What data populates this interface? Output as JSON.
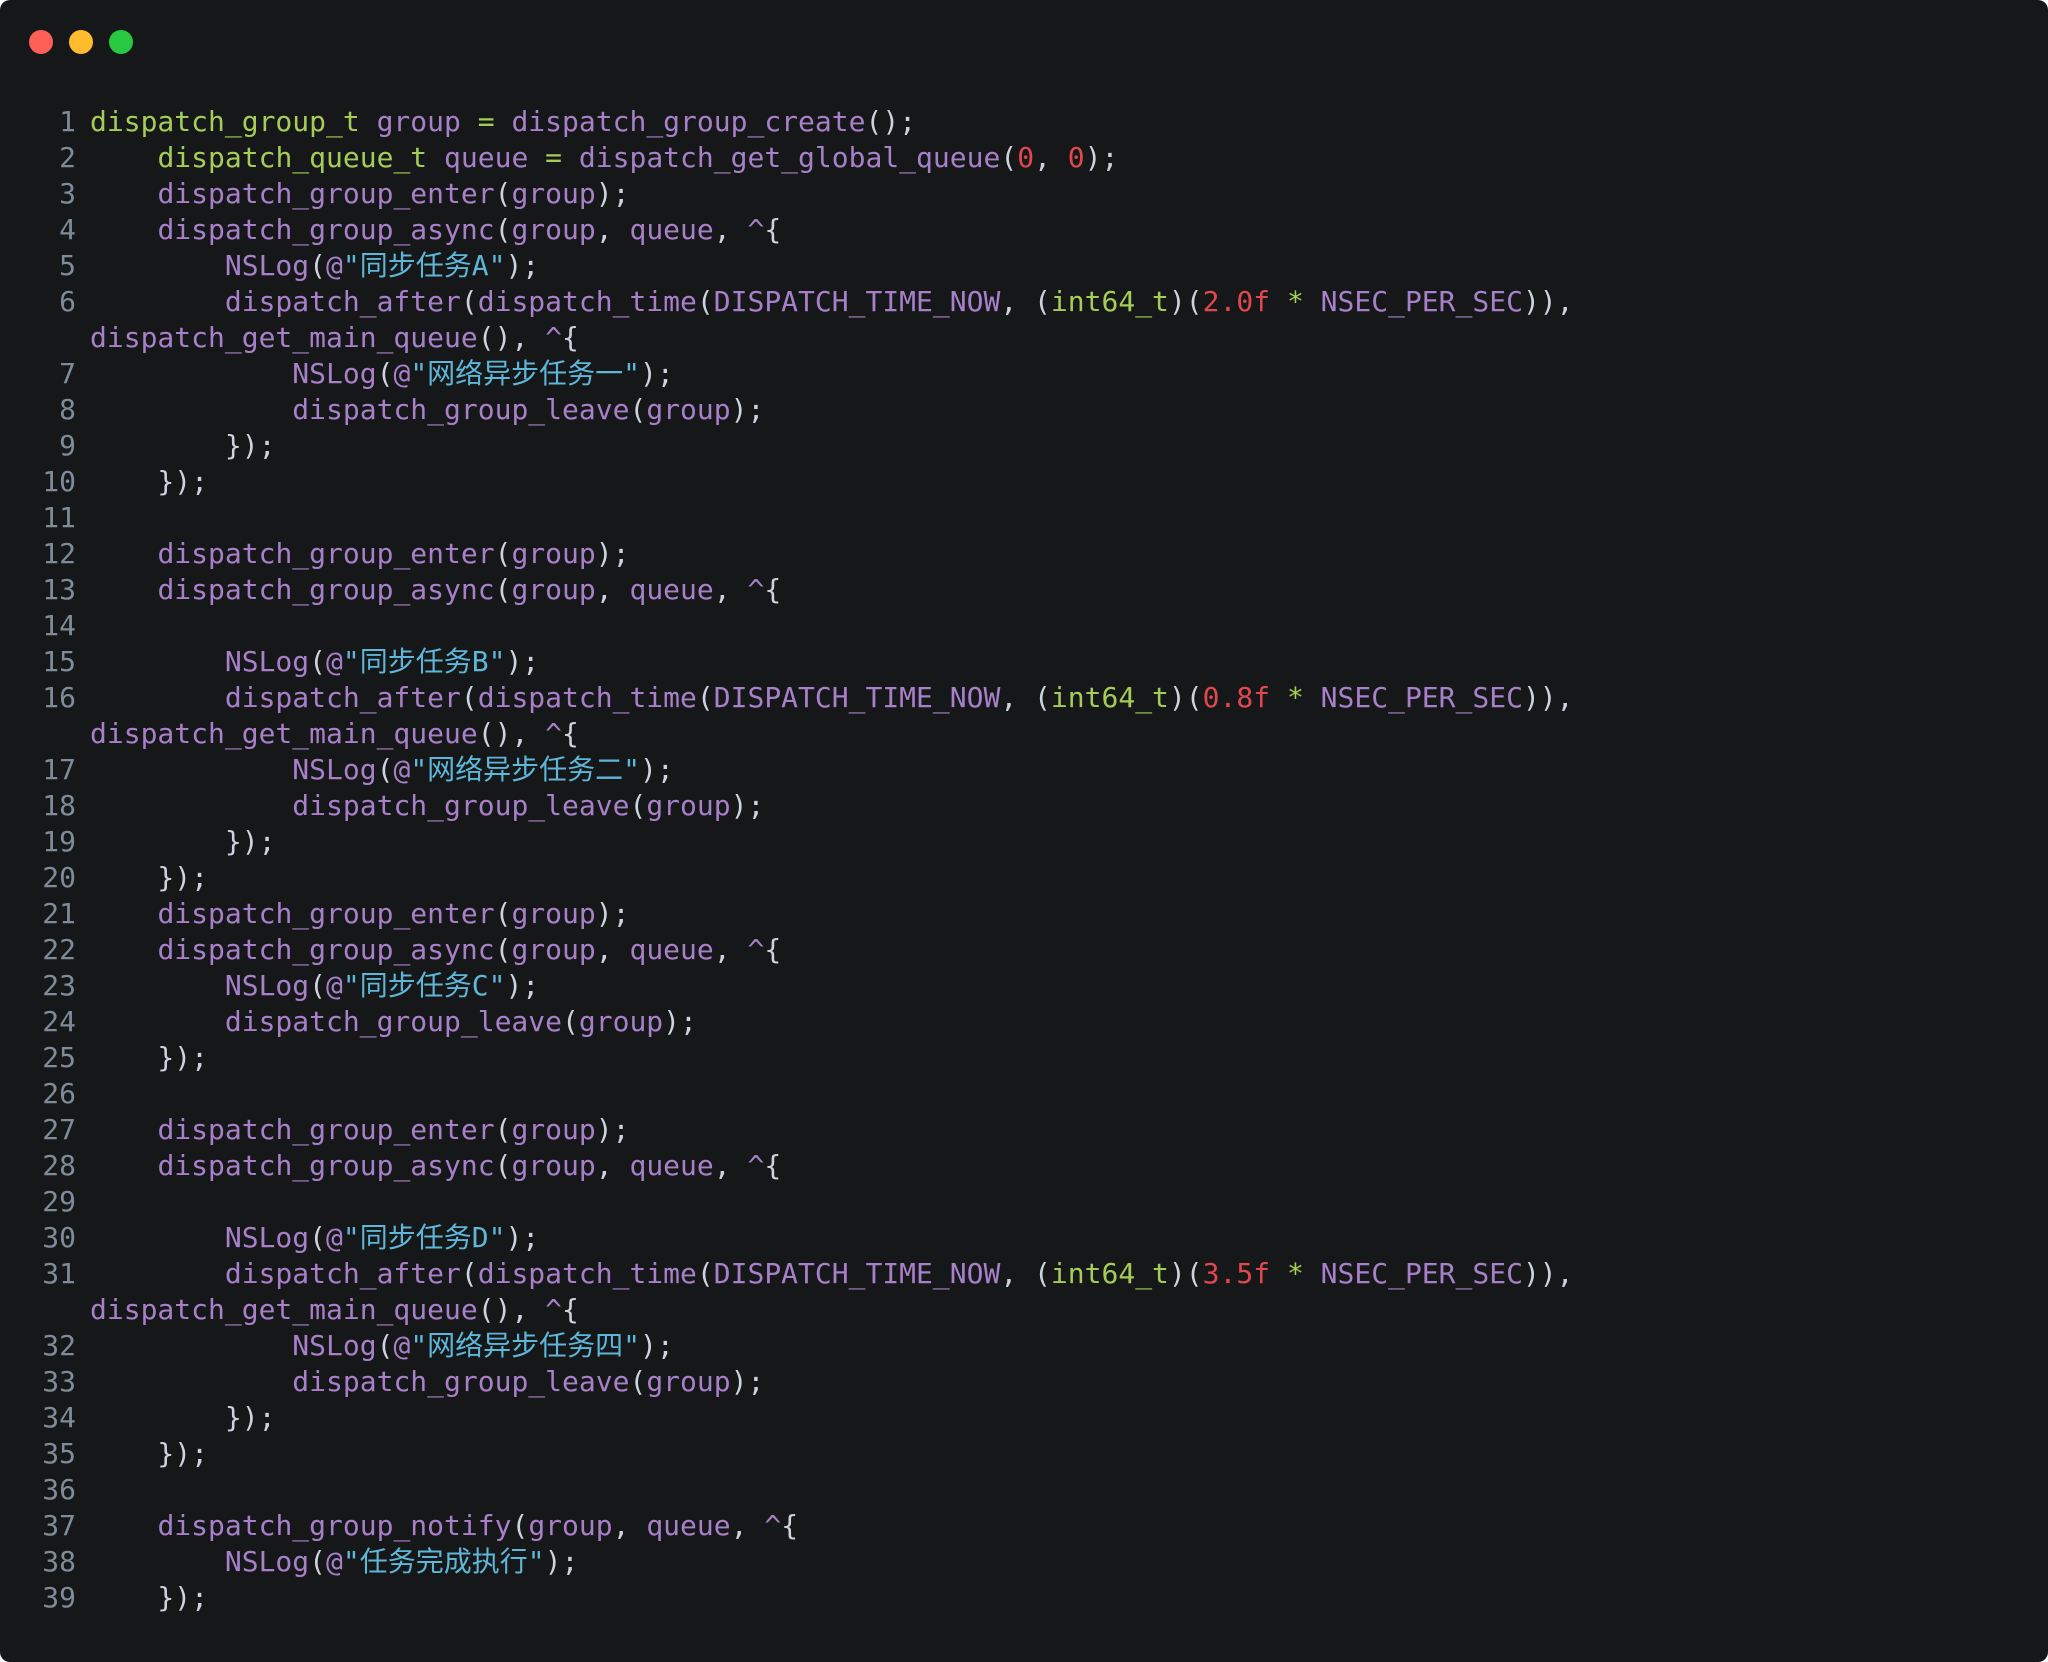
{
  "window": {
    "controls": {
      "close_color": "#fe5f57",
      "minimize_color": "#febc2e",
      "zoom_color": "#28c840"
    }
  },
  "theme": {
    "background": "#151719",
    "text": "#cdd3de",
    "line_number": "#7f8b98",
    "type": "#a6cc58",
    "function": "#a880c9",
    "number": "#e0474f",
    "string": "#5eb6d8"
  },
  "code_lines": [
    {
      "n": "1",
      "tokens": [
        [
          "type",
          "dispatch_group_t"
        ],
        [
          "p",
          " "
        ],
        [
          "fn",
          "group"
        ],
        [
          "p",
          " "
        ],
        [
          "op",
          "="
        ],
        [
          "p",
          " "
        ],
        [
          "fn",
          "dispatch_group_create"
        ],
        [
          "p",
          "();"
        ]
      ]
    },
    {
      "n": "2",
      "tokens": [
        [
          "p",
          "    "
        ],
        [
          "type",
          "dispatch_queue_t"
        ],
        [
          "p",
          " "
        ],
        [
          "fn",
          "queue"
        ],
        [
          "p",
          " "
        ],
        [
          "op",
          "="
        ],
        [
          "p",
          " "
        ],
        [
          "fn",
          "dispatch_get_global_queue"
        ],
        [
          "p",
          "("
        ],
        [
          "num",
          "0"
        ],
        [
          "p",
          ", "
        ],
        [
          "num",
          "0"
        ],
        [
          "p",
          ");"
        ]
      ]
    },
    {
      "n": "3",
      "tokens": [
        [
          "p",
          "    "
        ],
        [
          "fn",
          "dispatch_group_enter"
        ],
        [
          "p",
          "("
        ],
        [
          "fn",
          "group"
        ],
        [
          "p",
          ");"
        ]
      ]
    },
    {
      "n": "4",
      "tokens": [
        [
          "p",
          "    "
        ],
        [
          "fn",
          "dispatch_group_async"
        ],
        [
          "p",
          "("
        ],
        [
          "fn",
          "group"
        ],
        [
          "p",
          ", "
        ],
        [
          "fn",
          "queue"
        ],
        [
          "p",
          ", "
        ],
        [
          "fn",
          "^"
        ],
        [
          "p",
          "{"
        ]
      ]
    },
    {
      "n": "5",
      "tokens": [
        [
          "p",
          "        "
        ],
        [
          "fn",
          "NSLog"
        ],
        [
          "p",
          "("
        ],
        [
          "fn",
          "@"
        ],
        [
          "str",
          "\"同步任务A\""
        ],
        [
          "p",
          ");"
        ]
      ]
    },
    {
      "n": "6",
      "tokens": [
        [
          "p",
          "        "
        ],
        [
          "fn",
          "dispatch_after"
        ],
        [
          "p",
          "("
        ],
        [
          "fn",
          "dispatch_time"
        ],
        [
          "p",
          "("
        ],
        [
          "fn",
          "DISPATCH_TIME_NOW"
        ],
        [
          "p",
          ", ("
        ],
        [
          "type",
          "int64_t"
        ],
        [
          "p",
          ")("
        ],
        [
          "num",
          "2.0f"
        ],
        [
          "p",
          " "
        ],
        [
          "op",
          "*"
        ],
        [
          "p",
          " "
        ],
        [
          "fn",
          "NSEC_PER_SEC"
        ],
        [
          "p",
          ")),"
        ]
      ]
    },
    {
      "n": "",
      "tokens": [
        [
          "fn",
          "dispatch_get_main_queue"
        ],
        [
          "p",
          "(), "
        ],
        [
          "fn",
          "^"
        ],
        [
          "p",
          "{"
        ]
      ]
    },
    {
      "n": "7",
      "tokens": [
        [
          "p",
          "            "
        ],
        [
          "fn",
          "NSLog"
        ],
        [
          "p",
          "("
        ],
        [
          "fn",
          "@"
        ],
        [
          "str",
          "\"网络异步任务一\""
        ],
        [
          "p",
          ");"
        ]
      ]
    },
    {
      "n": "8",
      "tokens": [
        [
          "p",
          "            "
        ],
        [
          "fn",
          "dispatch_group_leave"
        ],
        [
          "p",
          "("
        ],
        [
          "fn",
          "group"
        ],
        [
          "p",
          ");"
        ]
      ]
    },
    {
      "n": "9",
      "tokens": [
        [
          "p",
          "        });"
        ]
      ]
    },
    {
      "n": "10",
      "tokens": [
        [
          "p",
          "    });"
        ]
      ]
    },
    {
      "n": "11",
      "tokens": []
    },
    {
      "n": "12",
      "tokens": [
        [
          "p",
          "    "
        ],
        [
          "fn",
          "dispatch_group_enter"
        ],
        [
          "p",
          "("
        ],
        [
          "fn",
          "group"
        ],
        [
          "p",
          ");"
        ]
      ]
    },
    {
      "n": "13",
      "tokens": [
        [
          "p",
          "    "
        ],
        [
          "fn",
          "dispatch_group_async"
        ],
        [
          "p",
          "("
        ],
        [
          "fn",
          "group"
        ],
        [
          "p",
          ", "
        ],
        [
          "fn",
          "queue"
        ],
        [
          "p",
          ", "
        ],
        [
          "fn",
          "^"
        ],
        [
          "p",
          "{"
        ]
      ]
    },
    {
      "n": "14",
      "tokens": []
    },
    {
      "n": "15",
      "tokens": [
        [
          "p",
          "        "
        ],
        [
          "fn",
          "NSLog"
        ],
        [
          "p",
          "("
        ],
        [
          "fn",
          "@"
        ],
        [
          "str",
          "\"同步任务B\""
        ],
        [
          "p",
          ");"
        ]
      ]
    },
    {
      "n": "16",
      "tokens": [
        [
          "p",
          "        "
        ],
        [
          "fn",
          "dispatch_after"
        ],
        [
          "p",
          "("
        ],
        [
          "fn",
          "dispatch_time"
        ],
        [
          "p",
          "("
        ],
        [
          "fn",
          "DISPATCH_TIME_NOW"
        ],
        [
          "p",
          ", ("
        ],
        [
          "type",
          "int64_t"
        ],
        [
          "p",
          ")("
        ],
        [
          "num",
          "0.8f"
        ],
        [
          "p",
          " "
        ],
        [
          "op",
          "*"
        ],
        [
          "p",
          " "
        ],
        [
          "fn",
          "NSEC_PER_SEC"
        ],
        [
          "p",
          ")),"
        ]
      ]
    },
    {
      "n": "",
      "tokens": [
        [
          "fn",
          "dispatch_get_main_queue"
        ],
        [
          "p",
          "(), "
        ],
        [
          "fn",
          "^"
        ],
        [
          "p",
          "{"
        ]
      ]
    },
    {
      "n": "17",
      "tokens": [
        [
          "p",
          "            "
        ],
        [
          "fn",
          "NSLog"
        ],
        [
          "p",
          "("
        ],
        [
          "fn",
          "@"
        ],
        [
          "str",
          "\"网络异步任务二\""
        ],
        [
          "p",
          ");"
        ]
      ]
    },
    {
      "n": "18",
      "tokens": [
        [
          "p",
          "            "
        ],
        [
          "fn",
          "dispatch_group_leave"
        ],
        [
          "p",
          "("
        ],
        [
          "fn",
          "group"
        ],
        [
          "p",
          ");"
        ]
      ]
    },
    {
      "n": "19",
      "tokens": [
        [
          "p",
          "        });"
        ]
      ]
    },
    {
      "n": "20",
      "tokens": [
        [
          "p",
          "    });"
        ]
      ]
    },
    {
      "n": "21",
      "tokens": [
        [
          "p",
          "    "
        ],
        [
          "fn",
          "dispatch_group_enter"
        ],
        [
          "p",
          "("
        ],
        [
          "fn",
          "group"
        ],
        [
          "p",
          ");"
        ]
      ]
    },
    {
      "n": "22",
      "tokens": [
        [
          "p",
          "    "
        ],
        [
          "fn",
          "dispatch_group_async"
        ],
        [
          "p",
          "("
        ],
        [
          "fn",
          "group"
        ],
        [
          "p",
          ", "
        ],
        [
          "fn",
          "queue"
        ],
        [
          "p",
          ", "
        ],
        [
          "fn",
          "^"
        ],
        [
          "p",
          "{"
        ]
      ]
    },
    {
      "n": "23",
      "tokens": [
        [
          "p",
          "        "
        ],
        [
          "fn",
          "NSLog"
        ],
        [
          "p",
          "("
        ],
        [
          "fn",
          "@"
        ],
        [
          "str",
          "\"同步任务C\""
        ],
        [
          "p",
          ");"
        ]
      ]
    },
    {
      "n": "24",
      "tokens": [
        [
          "p",
          "        "
        ],
        [
          "fn",
          "dispatch_group_leave"
        ],
        [
          "p",
          "("
        ],
        [
          "fn",
          "group"
        ],
        [
          "p",
          ");"
        ]
      ]
    },
    {
      "n": "25",
      "tokens": [
        [
          "p",
          "    });"
        ]
      ]
    },
    {
      "n": "26",
      "tokens": []
    },
    {
      "n": "27",
      "tokens": [
        [
          "p",
          "    "
        ],
        [
          "fn",
          "dispatch_group_enter"
        ],
        [
          "p",
          "("
        ],
        [
          "fn",
          "group"
        ],
        [
          "p",
          ");"
        ]
      ]
    },
    {
      "n": "28",
      "tokens": [
        [
          "p",
          "    "
        ],
        [
          "fn",
          "dispatch_group_async"
        ],
        [
          "p",
          "("
        ],
        [
          "fn",
          "group"
        ],
        [
          "p",
          ", "
        ],
        [
          "fn",
          "queue"
        ],
        [
          "p",
          ", "
        ],
        [
          "fn",
          "^"
        ],
        [
          "p",
          "{"
        ]
      ]
    },
    {
      "n": "29",
      "tokens": []
    },
    {
      "n": "30",
      "tokens": [
        [
          "p",
          "        "
        ],
        [
          "fn",
          "NSLog"
        ],
        [
          "p",
          "("
        ],
        [
          "fn",
          "@"
        ],
        [
          "str",
          "\"同步任务D\""
        ],
        [
          "p",
          ");"
        ]
      ]
    },
    {
      "n": "31",
      "tokens": [
        [
          "p",
          "        "
        ],
        [
          "fn",
          "dispatch_after"
        ],
        [
          "p",
          "("
        ],
        [
          "fn",
          "dispatch_time"
        ],
        [
          "p",
          "("
        ],
        [
          "fn",
          "DISPATCH_TIME_NOW"
        ],
        [
          "p",
          ", ("
        ],
        [
          "type",
          "int64_t"
        ],
        [
          "p",
          ")("
        ],
        [
          "num",
          "3.5f"
        ],
        [
          "p",
          " "
        ],
        [
          "op",
          "*"
        ],
        [
          "p",
          " "
        ],
        [
          "fn",
          "NSEC_PER_SEC"
        ],
        [
          "p",
          ")),"
        ]
      ]
    },
    {
      "n": "",
      "tokens": [
        [
          "fn",
          "dispatch_get_main_queue"
        ],
        [
          "p",
          "(), "
        ],
        [
          "fn",
          "^"
        ],
        [
          "p",
          "{"
        ]
      ]
    },
    {
      "n": "32",
      "tokens": [
        [
          "p",
          "            "
        ],
        [
          "fn",
          "NSLog"
        ],
        [
          "p",
          "("
        ],
        [
          "fn",
          "@"
        ],
        [
          "str",
          "\"网络异步任务四\""
        ],
        [
          "p",
          ");"
        ]
      ]
    },
    {
      "n": "33",
      "tokens": [
        [
          "p",
          "            "
        ],
        [
          "fn",
          "dispatch_group_leave"
        ],
        [
          "p",
          "("
        ],
        [
          "fn",
          "group"
        ],
        [
          "p",
          ");"
        ]
      ]
    },
    {
      "n": "34",
      "tokens": [
        [
          "p",
          "        });"
        ]
      ]
    },
    {
      "n": "35",
      "tokens": [
        [
          "p",
          "    });"
        ]
      ]
    },
    {
      "n": "36",
      "tokens": []
    },
    {
      "n": "37",
      "tokens": [
        [
          "p",
          "    "
        ],
        [
          "fn",
          "dispatch_group_notify"
        ],
        [
          "p",
          "("
        ],
        [
          "fn",
          "group"
        ],
        [
          "p",
          ", "
        ],
        [
          "fn",
          "queue"
        ],
        [
          "p",
          ", "
        ],
        [
          "fn",
          "^"
        ],
        [
          "p",
          "{"
        ]
      ]
    },
    {
      "n": "38",
      "tokens": [
        [
          "p",
          "        "
        ],
        [
          "fn",
          "NSLog"
        ],
        [
          "p",
          "("
        ],
        [
          "fn",
          "@"
        ],
        [
          "str",
          "\"任务完成执行\""
        ],
        [
          "p",
          ");"
        ]
      ]
    },
    {
      "n": "39",
      "tokens": [
        [
          "p",
          "    });"
        ]
      ]
    }
  ]
}
